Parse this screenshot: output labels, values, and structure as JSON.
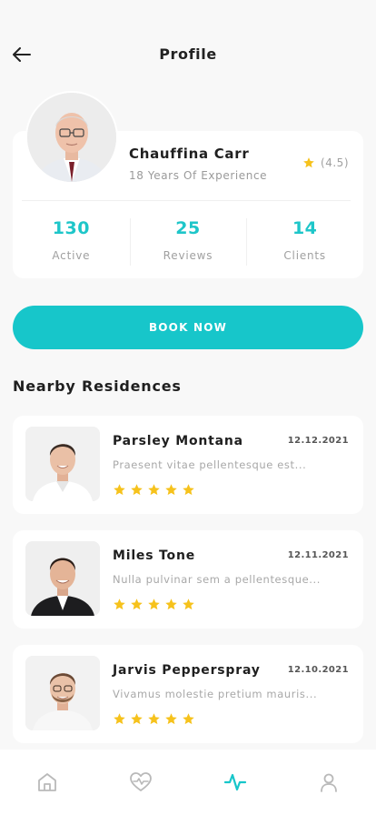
{
  "header": {
    "title": "Profile"
  },
  "doctor": {
    "name": "Chauffina Carr",
    "experience": "18 Years Of Experience",
    "rating": "(4.5)"
  },
  "stats": [
    {
      "value": "130",
      "label": "Active"
    },
    {
      "value": "25",
      "label": "Reviews"
    },
    {
      "value": "14",
      "label": "Clients"
    }
  ],
  "book_button": {
    "label": "BOOK NOW"
  },
  "section": {
    "title": "Nearby Residences"
  },
  "residences": [
    {
      "name": "Parsley Montana",
      "date": "12.12.2021",
      "description": "Praesent vitae pellentesque est...",
      "stars": 5
    },
    {
      "name": "Miles Tone",
      "date": "12.11.2021",
      "description": "Nulla pulvinar sem a pellentesque...",
      "stars": 5
    },
    {
      "name": "Jarvis Pepperspray",
      "date": "12.10.2021",
      "description": "Vivamus molestie pretium mauris...",
      "stars": 5
    }
  ],
  "nav": {
    "items": [
      "home-icon",
      "heart-pulse-icon",
      "activity-icon",
      "user-icon"
    ],
    "active": "activity-icon"
  },
  "colors": {
    "accent": "#17c6ca",
    "star": "#f6c21c",
    "text": "#1f1f1f",
    "muted": "#a0a0a0"
  }
}
